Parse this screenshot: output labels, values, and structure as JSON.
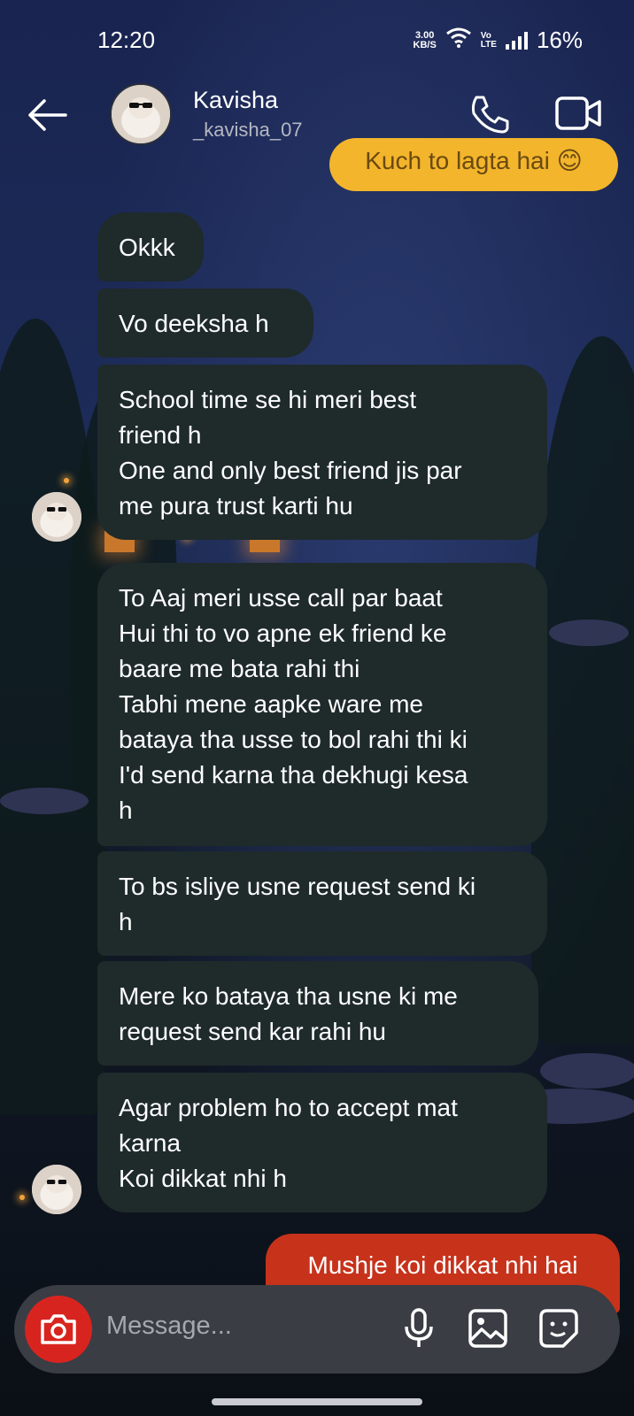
{
  "status_bar": {
    "time": "12:20",
    "net_speed": "3.00",
    "net_unit": "KB/S",
    "volte_top": "Vo",
    "volte_bottom": "LTE",
    "battery": "16%"
  },
  "header": {
    "name": "Kavisha",
    "username": "_kavisha_07",
    "back_icon": "arrow-left-icon",
    "call_icon": "phone-icon",
    "video_icon": "video-camera-icon"
  },
  "messages": [
    {
      "from": "me",
      "text": "Kuch to lagta hai 😊"
    },
    {
      "from": "them",
      "text": "Okkk"
    },
    {
      "from": "them",
      "text": "Vo deeksha h"
    },
    {
      "from": "them",
      "text": "School time se hi meri best\nfriend h\nOne and only best friend jis par\nme pura trust karti hu"
    },
    {
      "from": "them",
      "text": "To Aaj meri usse call par baat\nHui thi to vo apne ek friend ke\nbaare me bata rahi thi\nTabhi mene aapke ware me\nbataya tha usse to bol rahi thi ki\nI'd send karna tha dekhugi kesa\nh"
    },
    {
      "from": "them",
      "text": "To bs isliye usne request send ki\nh"
    },
    {
      "from": "them",
      "text": "Mere ko bataya tha usne ki me\nrequest send kar rahi hu"
    },
    {
      "from": "them",
      "text": "Agar problem ho to accept mat\nkarna\nKoi dikkat nhi h"
    },
    {
      "from": "me",
      "text": "Mushje koi dikkat nhi hai"
    }
  ],
  "composer": {
    "placeholder": "Message...",
    "icons": [
      "camera-icon",
      "microphone-icon",
      "image-icon",
      "sticker-icon"
    ]
  },
  "colors": {
    "sent_yellow": "#f3b52c",
    "sent_red": "#c7321b",
    "received_bubble": "#1f2a2b",
    "camera_button": "#d8241f",
    "composer_bg": "#3a3d44"
  }
}
